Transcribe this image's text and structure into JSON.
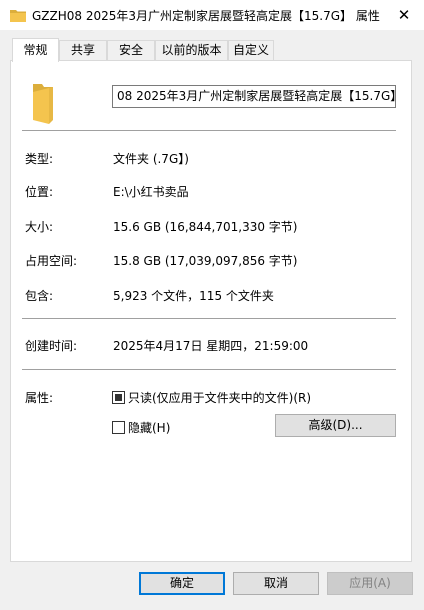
{
  "window": {
    "title": "GZZH08 2025年3月广州定制家居展暨轻高定展【15.7G】 属性",
    "close_glyph": "✕"
  },
  "tabs": [
    {
      "label": "常规",
      "active": true
    },
    {
      "label": "共享",
      "active": false
    },
    {
      "label": "安全",
      "active": false
    },
    {
      "label": "以前的版本",
      "active": false
    },
    {
      "label": "自定义",
      "active": false
    }
  ],
  "general": {
    "name_value": "08 2025年3月广州定制家居展暨轻高定展【15.7G】",
    "type": {
      "label": "类型:",
      "value": "文件夹 (.7G】)"
    },
    "location": {
      "label": "位置:",
      "value": "E:\\小红书卖品"
    },
    "size": {
      "label": "大小:",
      "value": "15.6 GB (16,844,701,330 字节)"
    },
    "size_on_disk": {
      "label": "占用空间:",
      "value": "15.8 GB (17,039,097,856 字节)"
    },
    "contains": {
      "label": "包含:",
      "value": "5,923 个文件，115 个文件夹"
    },
    "created": {
      "label": "创建时间:",
      "value": "2025年4月17日 星期四，21:59:00"
    },
    "attributes": {
      "label": "属性:",
      "readonly": {
        "label": "只读(仅应用于文件夹中的文件)(R)",
        "checked": true
      },
      "hidden": {
        "label": "隐藏(H)",
        "checked": false
      },
      "advanced_button": "高级(D)..."
    }
  },
  "footer": {
    "ok": "确定",
    "cancel": "取消",
    "apply": "应用(A)"
  },
  "icons": {
    "title": "folder-icon",
    "large": "folder-icon",
    "folder_color": "#f4c44e"
  }
}
